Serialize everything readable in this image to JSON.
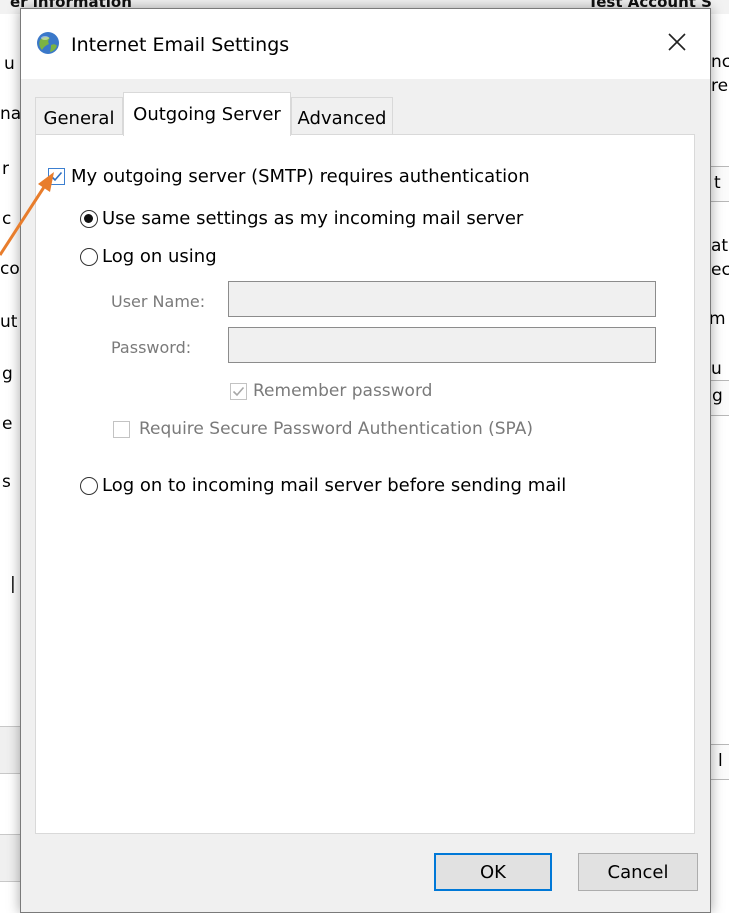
{
  "background_window": {
    "top_left_text": "er information",
    "top_right_text": "Test Account S",
    "left_fragments": [
      "u",
      "na",
      "r",
      "c",
      "co",
      "ut",
      "g",
      "e",
      "s",
      "|"
    ],
    "right_fragments": [
      "nc",
      "re",
      "t",
      "at",
      "ec",
      "m",
      "u",
      "g",
      "l"
    ]
  },
  "dialog": {
    "title": "Internet Email Settings",
    "app_icon": "internet-email-globe-icon",
    "close_icon": "close-icon",
    "tabs": [
      {
        "label": "General",
        "active": false
      },
      {
        "label": "Outgoing Server",
        "active": true
      },
      {
        "label": "Advanced",
        "active": false
      }
    ],
    "outgoing": {
      "requires_auth": {
        "label": "My outgoing server (SMTP) requires authentication",
        "checked": true
      },
      "use_same": {
        "label": "Use same settings as my incoming mail server",
        "selected": true
      },
      "log_on_using": {
        "label": "Log on using",
        "selected": false
      },
      "user_name": {
        "label": "User Name:",
        "value": ""
      },
      "password": {
        "label": "Password:",
        "value": ""
      },
      "remember_password": {
        "label": "Remember password",
        "checked": true,
        "enabled": false
      },
      "spa": {
        "label": "Require Secure Password Authentication (SPA)",
        "checked": false,
        "enabled": false
      },
      "log_on_incoming": {
        "label": "Log on to incoming mail server before sending mail",
        "selected": false
      }
    },
    "buttons": {
      "ok": "OK",
      "cancel": "Cancel"
    }
  },
  "annotation": {
    "arrow_color": "#e87d2c"
  },
  "colors": {
    "accent": "#0078d7",
    "checkbox_checked": "#3c7fd0"
  }
}
